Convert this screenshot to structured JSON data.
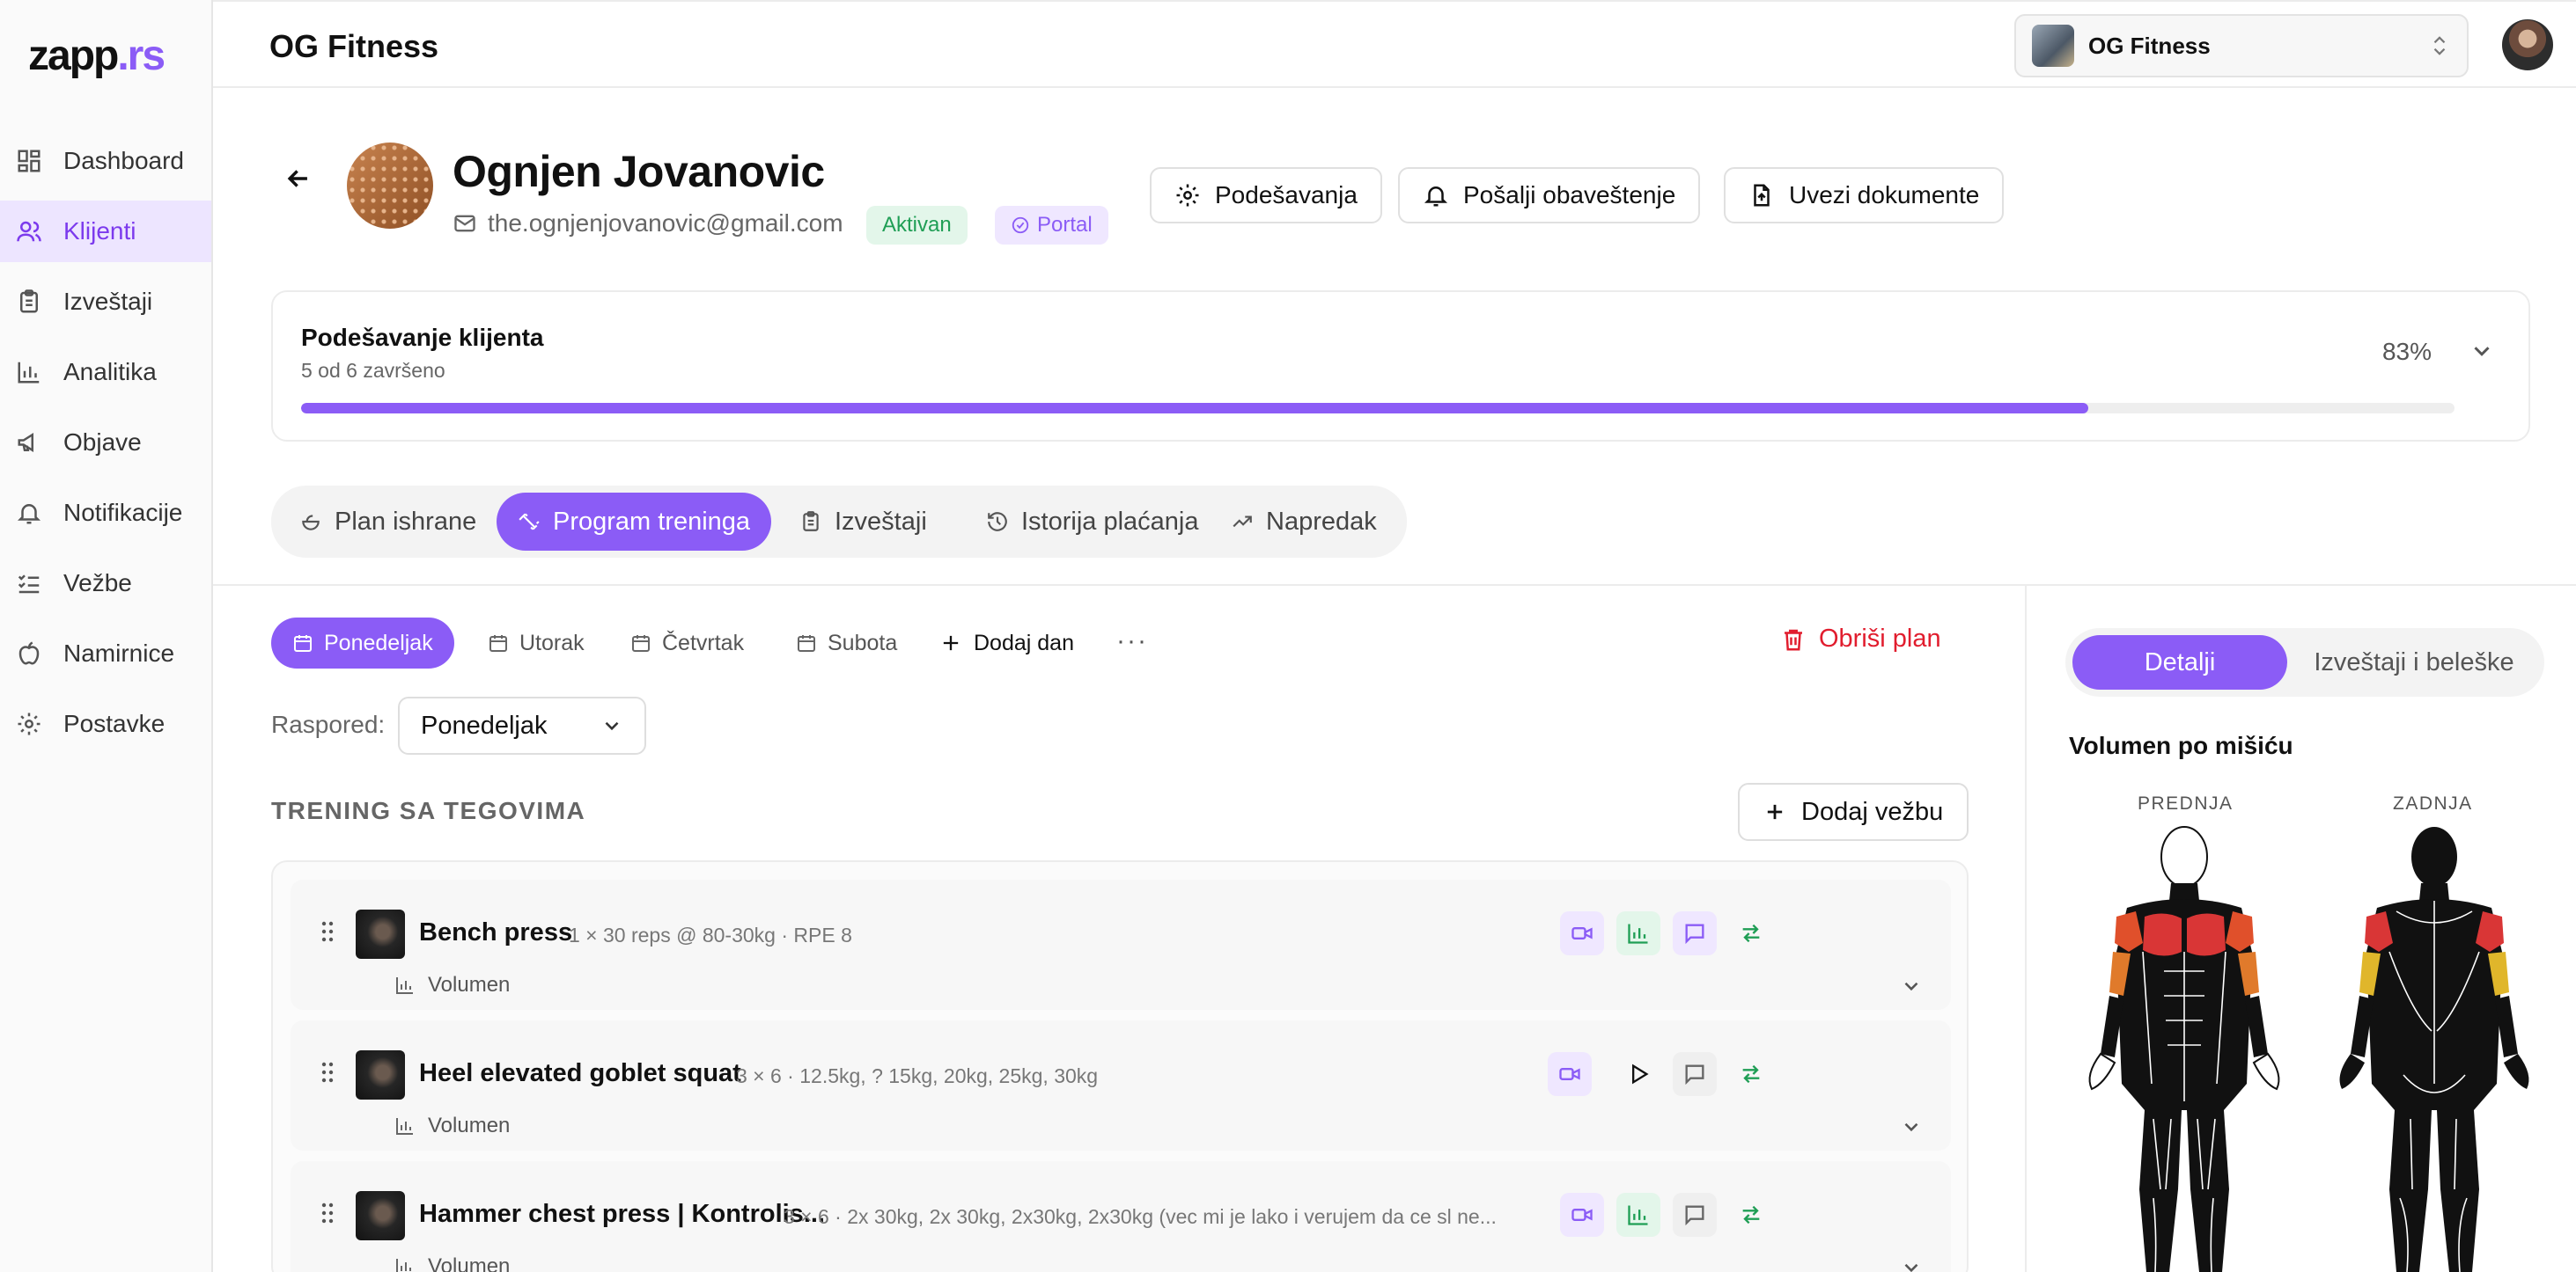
{
  "app": {
    "logo_main": "zapp",
    "logo_accent": ".rs",
    "page_title": "OG Fitness",
    "org_name": "OG Fitness",
    "accent_color": "#8b5cf6"
  },
  "sidebar": {
    "items": [
      {
        "label": "Dashboard",
        "icon": "dashboard-icon"
      },
      {
        "label": "Klijenti",
        "icon": "users-icon",
        "active": true
      },
      {
        "label": "Izveštaji",
        "icon": "clipboard-icon"
      },
      {
        "label": "Analitika",
        "icon": "bar-chart-icon"
      },
      {
        "label": "Objave",
        "icon": "megaphone-icon"
      },
      {
        "label": "Notifikacije",
        "icon": "bell-icon"
      },
      {
        "label": "Vežbe",
        "icon": "list-checks-icon"
      },
      {
        "label": "Namirnice",
        "icon": "apple-icon"
      },
      {
        "label": "Postavke",
        "icon": "gear-icon"
      }
    ]
  },
  "client": {
    "name": "Ognjen Jovanovic",
    "email": "the.ognjenjovanovic@gmail.com",
    "status_badge": "Aktivan",
    "portal_badge": "Portal"
  },
  "header_buttons": {
    "settings": "Podešavanja",
    "notify": "Pošalji obaveštenje",
    "import": "Uvezi dokumente"
  },
  "setup": {
    "title": "Podešavanje klijenta",
    "subtitle": "5 od 6 završeno",
    "percent_label": "83%",
    "progress": 0.83
  },
  "tabs": [
    {
      "label": "Plan ishrane",
      "icon": "food-icon"
    },
    {
      "label": "Program treninga",
      "icon": "dumbbell-icon",
      "active": true
    },
    {
      "label": "Izveštaji",
      "icon": "clipboard-icon"
    },
    {
      "label": "Istorija plaćanja",
      "icon": "history-icon"
    },
    {
      "label": "Napredak",
      "icon": "trending-up-icon"
    }
  ],
  "days": [
    {
      "label": "Ponedeljak",
      "active": true
    },
    {
      "label": "Utorak"
    },
    {
      "label": "Četvrtak"
    },
    {
      "label": "Subota"
    }
  ],
  "day_actions": {
    "add_day": "Dodaj dan",
    "more": "···",
    "delete_plan": "Obriši plan"
  },
  "schedule": {
    "label": "Raspored:",
    "value": "Ponedeljak"
  },
  "workout": {
    "section_title": "TRENING SA TEGOVIMA",
    "add_exercise": "Dodaj vežbu",
    "volume_label": "Volumen",
    "exercises": [
      {
        "name": "Bench press",
        "detail": "1 × 30 reps @ 80-30kg · RPE 8"
      },
      {
        "name": "Heel elevated goblet squat",
        "detail": "3 × 6 · 12.5kg, ? 15kg, 20kg, 25kg, 30kg"
      },
      {
        "name": "Hammer chest press | Kontrolis...",
        "detail": "3 × 6 · 2x 30kg, 2x 30kg, 2x30kg, 2x30kg (vec mi je lako i verujem da ce sl ne..."
      }
    ]
  },
  "right_panel": {
    "tab_details": "Detalji",
    "tab_reports": "Izveštaji i beleške",
    "volume_title": "Volumen po mišiću",
    "front_label": "PREDNJA",
    "back_label": "ZADNJA"
  }
}
